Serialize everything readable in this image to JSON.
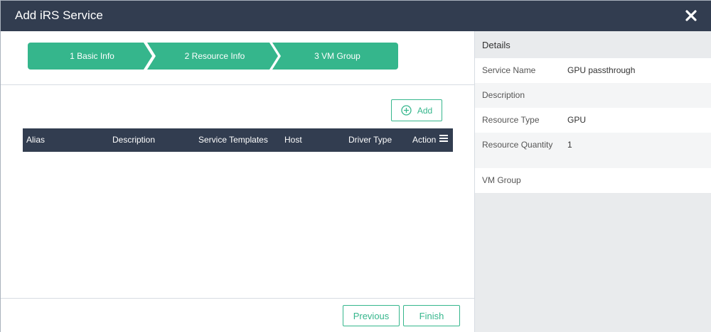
{
  "dialog": {
    "title": "Add iRS Service",
    "close_icon": "close-icon"
  },
  "wizard": {
    "steps": [
      {
        "label": "1 Basic Info"
      },
      {
        "label": "2 Resource Info"
      },
      {
        "label": "3 VM Group"
      }
    ],
    "accent_color": "#35b68c"
  },
  "toolbar": {
    "add_label": "Add",
    "add_icon": "plus-circle-icon"
  },
  "table": {
    "columns": [
      "Alias",
      "Description",
      "Service Templates",
      "Host",
      "Driver Type",
      "Action"
    ],
    "menu_icon": "column-menu-icon",
    "rows": []
  },
  "footer": {
    "previous_label": "Previous",
    "finish_label": "Finish"
  },
  "details": {
    "title": "Details",
    "rows": [
      {
        "key": "Service Name",
        "value": "GPU passthrough"
      },
      {
        "key": "Description",
        "value": ""
      },
      {
        "key": "Resource Type",
        "value": "GPU"
      },
      {
        "key": "Resource Quantity",
        "value": "1"
      },
      {
        "key": "VM Group",
        "value": ""
      }
    ]
  },
  "colors": {
    "header_bg": "#323d50",
    "panel_bg": "#e9ebed"
  }
}
